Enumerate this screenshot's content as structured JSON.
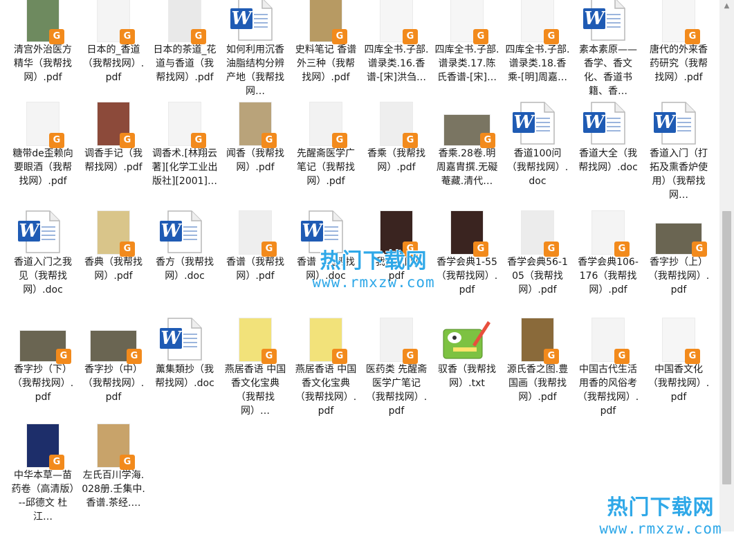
{
  "files": [
    {
      "label": "清宫外治医方精华（我帮找网）.pdf",
      "type": "pdf",
      "thumb": "#6e8a5f"
    },
    {
      "label": "日本的_香道（我帮找网）.pdf",
      "type": "pdf",
      "thumb": "#f4f4f4"
    },
    {
      "label": "日本的茶道_花道与香道（我帮找网）.pdf",
      "type": "pdf",
      "thumb": "#e9e9e9"
    },
    {
      "label": "如何利用沉香油脂结构分辨产地（我帮找网…",
      "type": "doc"
    },
    {
      "label": "史料笔记 香谱 外三种（我帮找网）.pdf",
      "type": "pdf",
      "thumb": "#b79a63"
    },
    {
      "label": "四库全书.子部.谱录类.16.香谱-[宋]洪刍…",
      "type": "pdf",
      "thumb": "#f6f6f6"
    },
    {
      "label": "四库全书.子部.谱录类.17.陈氏香谱-[宋]…",
      "type": "pdf",
      "thumb": "#f6f6f6"
    },
    {
      "label": "四库全书.子部.谱录类.18.香乘-[明]周嘉…",
      "type": "pdf",
      "thumb": "#f6f6f6"
    },
    {
      "label": "素本素原——香学、香文化、香道书籍、香…",
      "type": "doc"
    },
    {
      "label": "唐代的外来香药研究（我帮找网）.pdf",
      "type": "pdf",
      "thumb": "#f6f6f6"
    },
    {
      "label": "糖带de歪赖向要眼酒（我帮找网）.pdf",
      "type": "pdf",
      "thumb": "#f4f4f4"
    },
    {
      "label": "调香手记（我帮找网）.pdf",
      "type": "pdf",
      "thumb": "#8c4a3a"
    },
    {
      "label": "调香术.[林翔云著][化学工业出版社][2001]…",
      "type": "pdf",
      "thumb": "#f4f4f4"
    },
    {
      "label": "闻香（我帮找网）.pdf",
      "type": "pdf",
      "thumb": "#b9a37a"
    },
    {
      "label": "先醒斋医学广笔记（我帮找网）.pdf",
      "type": "pdf",
      "thumb": "#f2f2f2"
    },
    {
      "label": "香乘（我帮找网）.pdf",
      "type": "pdf",
      "thumb": "#eeeeee"
    },
    {
      "label": "香乘.28卷.明周嘉胄撰.无礙菴藏.清代…",
      "type": "pdf",
      "thumb": "#7a7562"
    },
    {
      "label": "香道100问（我帮找网）.doc",
      "type": "doc"
    },
    {
      "label": "香道大全（我帮找网）.doc",
      "type": "doc"
    },
    {
      "label": "香道入门（打拓及熏香炉使用）（我帮找网…",
      "type": "doc"
    },
    {
      "label": "香道入门之我见（我帮找网）.doc",
      "type": "doc"
    },
    {
      "label": "香典（我帮找网）.pdf",
      "type": "pdf",
      "thumb": "#d9c58a"
    },
    {
      "label": "香方（我帮找网）.doc",
      "type": "doc"
    },
    {
      "label": "香谱（我帮找网）.pdf",
      "type": "pdf",
      "thumb": "#eeeeee"
    },
    {
      "label": "香谱（我帮找网）.doc",
      "type": "doc"
    },
    {
      "label": "（我帮找网）.pdf",
      "type": "pdf",
      "thumb": "#3a2420"
    },
    {
      "label": "香学会典1-55（我帮找网）.pdf",
      "type": "pdf",
      "thumb": "#3a2420"
    },
    {
      "label": "香学会典56-105（我帮找网）.pdf",
      "type": "pdf",
      "thumb": "#ececec"
    },
    {
      "label": "香学会典106-176（我帮找网）.pdf",
      "type": "pdf",
      "thumb": "#f4f4f4"
    },
    {
      "label": "香字抄（上）（我帮找网）.pdf",
      "type": "pdf",
      "thumb": "#6a6552"
    },
    {
      "label": "香字抄（下）（我帮找网）.pdf",
      "type": "pdf",
      "thumb": "#6a6552"
    },
    {
      "label": "香字抄（中）（我帮找网）.pdf",
      "type": "pdf",
      "thumb": "#6a6552"
    },
    {
      "label": "薰集類抄（我帮找网）.doc",
      "type": "doc"
    },
    {
      "label": "燕居香语 中国香文化宝典（我帮找网）…",
      "type": "pdf",
      "thumb": "#f2e27a"
    },
    {
      "label": "燕居香语 中国香文化宝典（我帮找网）.pdf",
      "type": "pdf",
      "thumb": "#f2e27a"
    },
    {
      "label": "医药类 先醒斋医学广笔记（我帮找网）.pdf",
      "type": "pdf",
      "thumb": "#f2f2f2"
    },
    {
      "label": "驭香（我帮找网）.txt",
      "type": "txt"
    },
    {
      "label": "源氏香之图.豊国画（我帮找网）.pdf",
      "type": "pdf",
      "thumb": "#8a6a3a"
    },
    {
      "label": "中国古代生活用香的风俗考（我帮找网）.pdf",
      "type": "pdf",
      "thumb": "#f4f4f4"
    },
    {
      "label": "中国香文化（我帮找网）.pdf",
      "type": "pdf",
      "thumb": "#f6f6f6"
    },
    {
      "label": "中华本草—苗药卷（高清版）--邱德文 杜江…",
      "type": "pdf",
      "thumb": "#1d2e6a"
    },
    {
      "label": "左氏百川学海.028册.壬集中.香谱.茶经.…",
      "type": "pdf",
      "thumb": "#c8a36a"
    }
  ],
  "badge_glyph": "G",
  "word_glyph": "W",
  "watermark_center": {
    "title": "热门下载网",
    "url": "www.rmxzw.com"
  },
  "watermark_corner": {
    "title": "热门下载网",
    "url": "www.rmxzw.com"
  },
  "colors": {
    "pdf_badge": "#f28a1c",
    "word_blue": "#1f5bb4",
    "watermark": "#2fa8e8"
  }
}
